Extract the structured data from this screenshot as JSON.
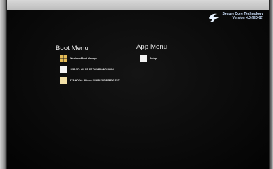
{
  "brand": {
    "line1": "Secure Core Technology",
    "line2": "Version 4.0 (EDK2)",
    "icon": "phoenix-logo-icon"
  },
  "boot_menu": {
    "title": "Boot Menu",
    "items": [
      {
        "label": "Windows Boot Manager",
        "icon": "windows-tile-icon"
      },
      {
        "label": "USB CD: HL-DT-ST DVDRAM GUD0N",
        "icon": "usb-tile-icon"
      },
      {
        "label": "ATA HDD0: Phison SSMP128GRBB00-S1T1",
        "icon": "hdd-tile-icon"
      }
    ]
  },
  "app_menu": {
    "title": "App Menu",
    "items": [
      {
        "label": "Setup",
        "icon": "setup-tile-icon"
      }
    ]
  },
  "colors": {
    "background": "#000000",
    "brand_text": "#cfe3ff",
    "windows_tile": "#e2ba57",
    "hdd_tile": "#f1dfa6"
  }
}
